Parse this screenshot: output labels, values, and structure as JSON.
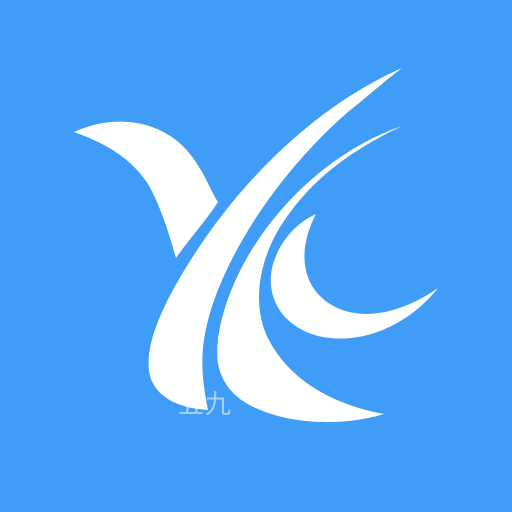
{
  "icon": {
    "name": "app-logo-icon",
    "background": "#3f9cf7",
    "foreground": "#ffffff"
  },
  "watermark": {
    "text": "五九"
  }
}
